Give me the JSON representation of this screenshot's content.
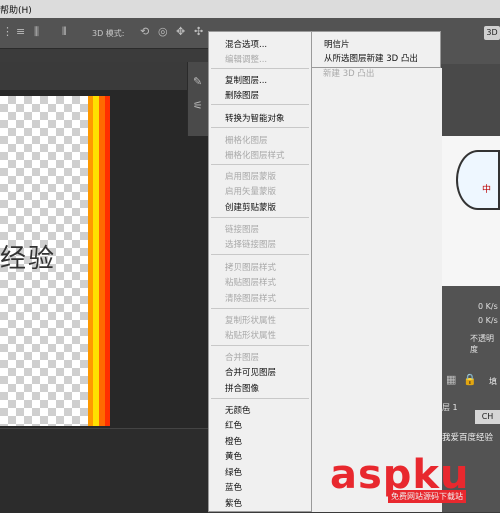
{
  "menubar": {
    "help_label": "帮助(H)"
  },
  "optionsbar": {
    "mode_3d_label": "3D 模式:",
    "button_3d": "3D"
  },
  "canvas": {
    "text": "经验"
  },
  "context_menu": {
    "items": [
      {
        "label": "混合选项...",
        "enabled": true
      },
      {
        "label": "编辑调整...",
        "enabled": false
      },
      {
        "label": "复制图层...",
        "enabled": true
      },
      {
        "label": "删除图层",
        "enabled": true
      },
      {
        "label": "转换为智能对象",
        "enabled": true
      },
      {
        "label": "栅格化图层",
        "enabled": false
      },
      {
        "label": "栅格化图层样式",
        "enabled": false
      },
      {
        "label": "启用图层蒙版",
        "enabled": false
      },
      {
        "label": "启用矢量蒙版",
        "enabled": false
      },
      {
        "label": "创建剪贴蒙版",
        "enabled": true
      },
      {
        "label": "链接图层",
        "enabled": false
      },
      {
        "label": "选择链接图层",
        "enabled": false
      },
      {
        "label": "拷贝图层样式",
        "enabled": false
      },
      {
        "label": "粘贴图层样式",
        "enabled": false
      },
      {
        "label": "清除图层样式",
        "enabled": false
      },
      {
        "label": "复制形状属性",
        "enabled": false
      },
      {
        "label": "粘贴形状属性",
        "enabled": false
      },
      {
        "label": "合并图层",
        "enabled": false
      },
      {
        "label": "合并可见图层",
        "enabled": true
      },
      {
        "label": "拼合图像",
        "enabled": true
      },
      {
        "label": "无颜色",
        "enabled": true
      },
      {
        "label": "红色",
        "enabled": true
      },
      {
        "label": "橙色",
        "enabled": true
      },
      {
        "label": "黄色",
        "enabled": true
      },
      {
        "label": "绿色",
        "enabled": true
      },
      {
        "label": "蓝色",
        "enabled": true
      },
      {
        "label": "紫色",
        "enabled": true
      }
    ]
  },
  "submenu": {
    "items": [
      {
        "label": "明信片",
        "enabled": true
      },
      {
        "label": "从所选图层新建 3D 凸出",
        "enabled": true
      },
      {
        "label": "新建 3D 凸出",
        "enabled": false
      }
    ]
  },
  "right_panel": {
    "kb_rate_1": "0 K/s",
    "kb_rate_2": "0 K/s",
    "opacity_label": "不透明度",
    "fill_label": "填",
    "ch_button": "CH",
    "layer_name": "层 1",
    "layer_label": "我爱百度经验"
  },
  "watermark": {
    "main": "aspku",
    "sub": "免费网站源码下载站"
  },
  "colors": {
    "menu_bg": "#f0f0f0",
    "disabled_text": "#a8a8a8",
    "workspace": "#3b3b3b",
    "watermark_red": "#e8282e"
  }
}
